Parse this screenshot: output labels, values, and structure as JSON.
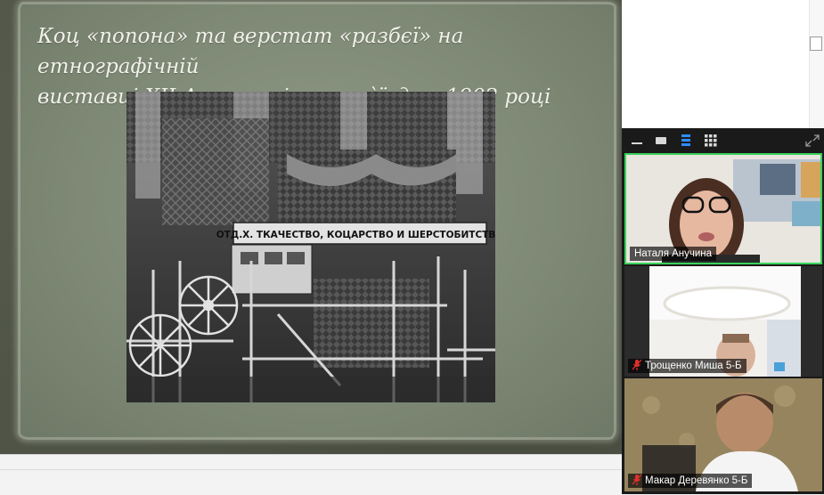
{
  "slide": {
    "title_line1": "Коц «попона» та верстат «разбєї» на етнографічній",
    "title_line2": "виставці XII Археологічного з`їзду в 1902 році",
    "photo_sign": "ОТД.Х. ТКАЧЕСТВО, КОЦАРСТВО И ШЕРСТОБИТСТВО"
  },
  "zoom": {
    "toolbar": {
      "minimize_icon": "minimize-icon",
      "view_small_icon": "video-small-icon",
      "view_strip_icon": "strip-view-icon",
      "view_gallery_icon": "gallery-grid-icon",
      "fullscreen_icon": "expand-icon"
    },
    "participants": [
      {
        "name": "Наталя Анучина",
        "muted": false,
        "active_speaker": true
      },
      {
        "name": "Трощенко Миша 5-Б",
        "muted": true,
        "active_speaker": false
      },
      {
        "name": "Макар Деревянко 5-Б",
        "muted": true,
        "active_speaker": false
      }
    ]
  },
  "colors": {
    "active_speaker_border": "#3ad35b",
    "muted_icon": "#e0302a",
    "strip_view_active": "#2d8cff"
  }
}
